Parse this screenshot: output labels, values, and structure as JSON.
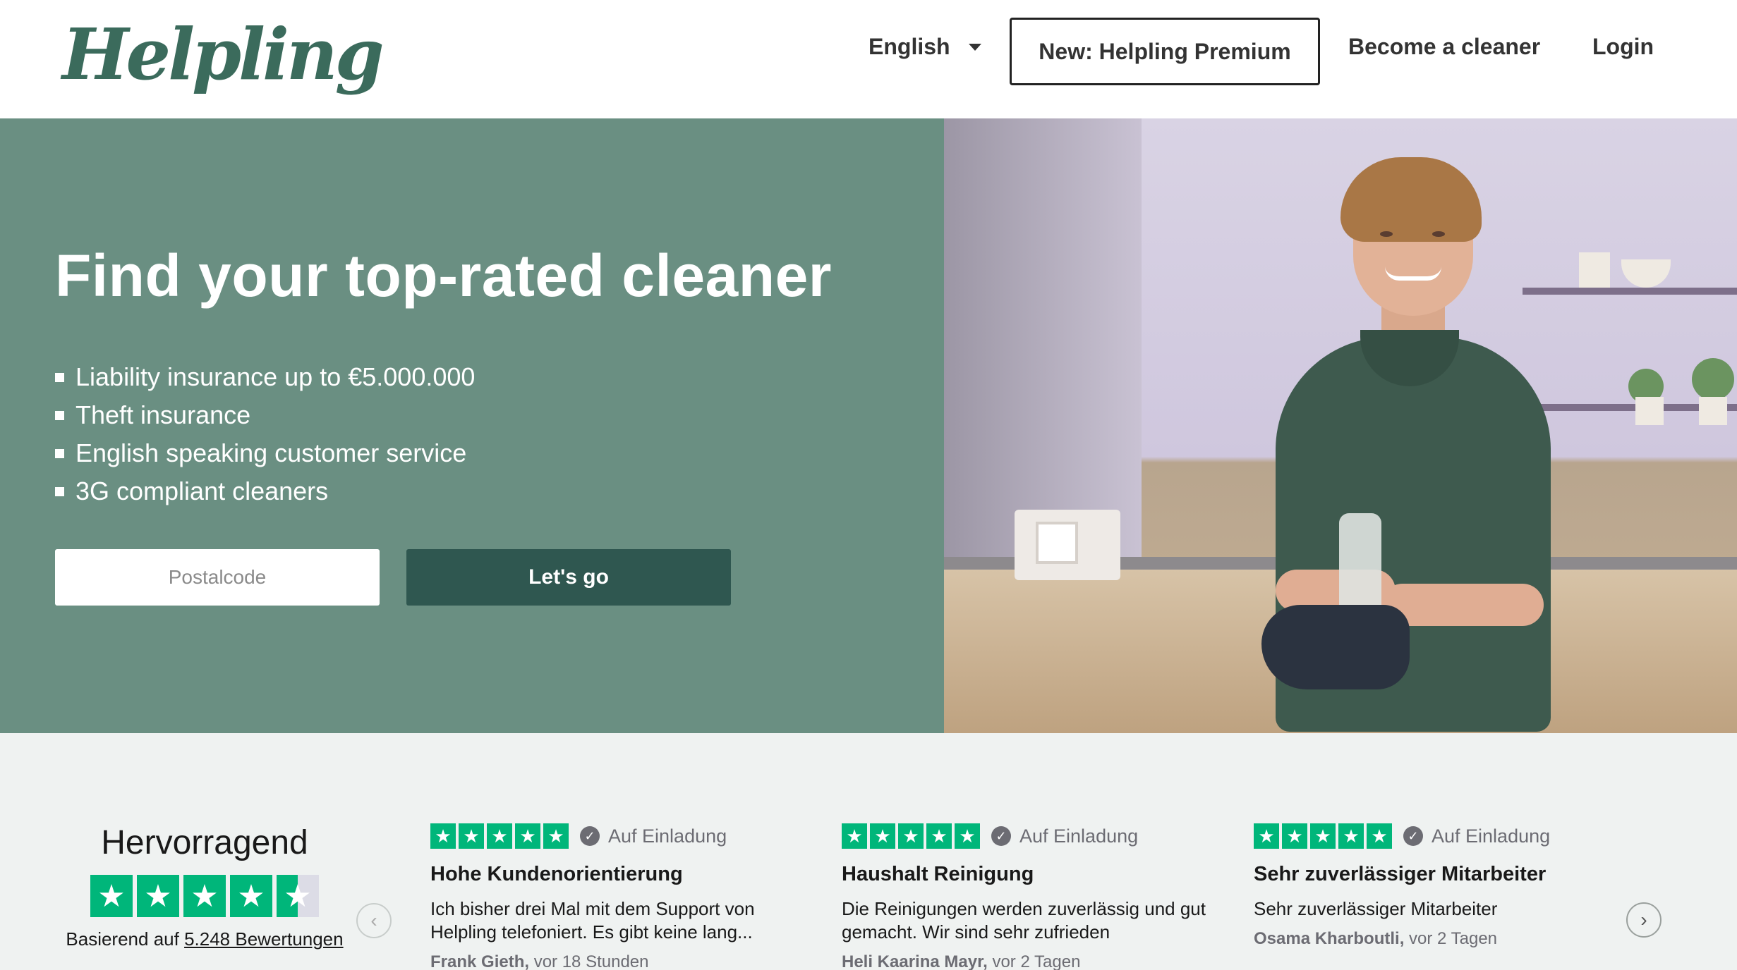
{
  "header": {
    "logo": "Helpling",
    "language": "English",
    "premium_button": "New: Helpling Premium",
    "become_cleaner": "Become a cleaner",
    "login": "Login"
  },
  "hero": {
    "title": "Find your top-rated cleaner",
    "features": [
      "Liability insurance up to €5.000.000",
      "Theft insurance",
      "English speaking customer service",
      "3G compliant cleaners"
    ],
    "postalcode_placeholder": "Postalcode",
    "cta_button": "Let's go"
  },
  "trustpilot": {
    "rating_text": "Hervorragend",
    "stars": 4.5,
    "based_on_prefix": "Basierend auf",
    "based_on_link": "5.248 Bewertungen"
  },
  "reviews": [
    {
      "stars": 5,
      "verified_label": "Auf Einladung",
      "title": "Hohe Kundenorientierung",
      "text": "Ich bisher drei Mal mit dem Support von Helpling telefoniert. Es gibt keine lang...",
      "author": "Frank Gieth,",
      "time": "vor 18 Stunden"
    },
    {
      "stars": 5,
      "verified_label": "Auf Einladung",
      "title": "Haushalt Reinigung",
      "text": "Die Reinigungen werden zuverlässig und gut gemacht. Wir sind sehr zufrieden",
      "author": "Heli Kaarina Mayr,",
      "time": "vor 2 Tagen"
    },
    {
      "stars": 5,
      "verified_label": "Auf Einladung",
      "title": "Sehr zuverlässiger Mitarbeiter",
      "text": "Sehr zuverlässiger Mitarbeiter",
      "author": "Osama Kharboutli,",
      "time": "vor 2 Tagen"
    }
  ],
  "colors": {
    "hero_green": "#6a8f82",
    "button_dark": "#2f5750",
    "logo_green": "#3b6b5c",
    "trustpilot_green": "#00b67a",
    "reviews_bg": "#eff2f1"
  },
  "icons": {
    "language_caret": "caret-down-icon",
    "star": "star-icon",
    "verified": "check-circle-icon",
    "carousel_prev": "chevron-left-icon",
    "carousel_next": "chevron-right-icon"
  }
}
